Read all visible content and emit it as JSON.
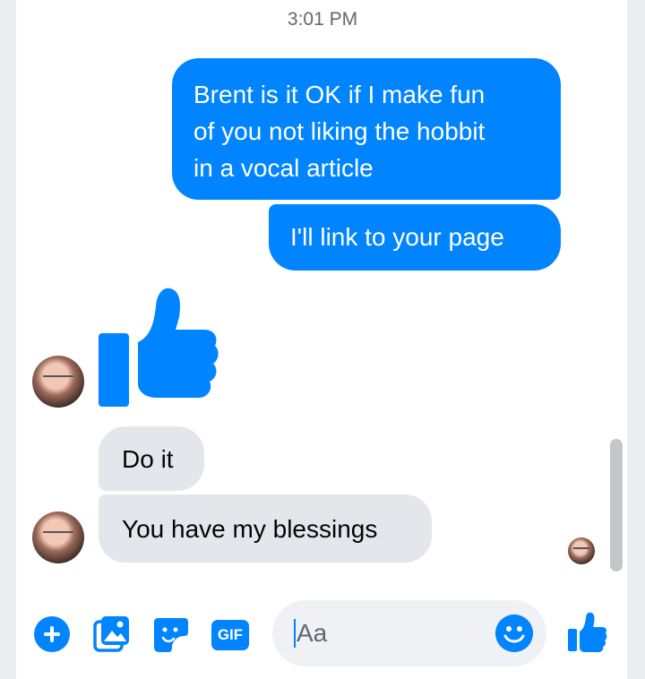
{
  "thread": {
    "timestamp": "3:01 PM",
    "messages": [
      {
        "from": "me",
        "lines": [
          "Brent is it OK if I make fun",
          "of you not liking the hobbit",
          "in a vocal article"
        ]
      },
      {
        "from": "me",
        "text": "I'll link to your page"
      },
      {
        "from": "them",
        "type": "like-sticker"
      },
      {
        "from": "them",
        "text": "Do it"
      },
      {
        "from": "them",
        "text": "You have my blessings"
      }
    ]
  },
  "composer": {
    "gif_label": "GIF",
    "placeholder": "Aa"
  },
  "icons": {
    "add": "plus-circle-icon",
    "photo": "photo-icon",
    "sticker": "sticker-icon",
    "gif": "gif-icon",
    "emoji": "smiley-icon",
    "like": "thumbs-up-icon"
  },
  "colors": {
    "accent": "#0084ff",
    "incoming_bubble": "#e4e6eb",
    "background": "#ffffff"
  }
}
